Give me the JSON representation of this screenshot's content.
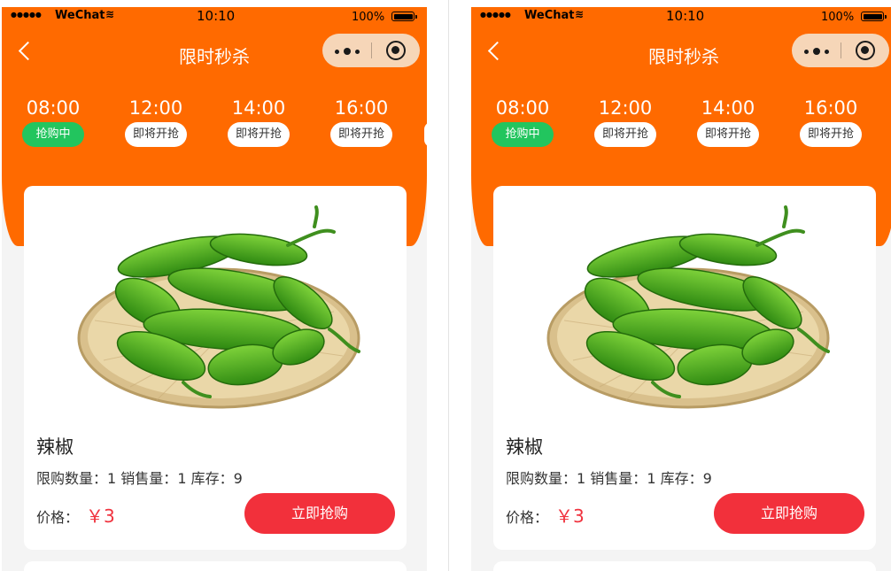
{
  "status_bar": {
    "signal": "●●●●●",
    "carrier": "WeChat",
    "time": "10:10",
    "battery_percent": "100%"
  },
  "header": {
    "title": "限时秒杀"
  },
  "time_tabs": [
    {
      "time": "08:00",
      "status": "抢购中",
      "active": true
    },
    {
      "time": "12:00",
      "status": "即将开抢",
      "active": false
    },
    {
      "time": "14:00",
      "status": "即将开抢",
      "active": false
    },
    {
      "time": "16:00",
      "status": "即将开抢",
      "active": false
    }
  ],
  "product": {
    "name": "辣椒",
    "limit_label": "限购数量：",
    "limit_value": "1",
    "sold_label": "销售量：",
    "sold_value": "1",
    "stock_label": "库存：",
    "stock_value": "9",
    "price_label": "价格：",
    "price": "￥3",
    "buy_button": "立即抢购"
  },
  "colors": {
    "header_orange": "#ff6a00",
    "active_green": "#22c55e",
    "buy_red": "#f2303b",
    "price_red": "#f0333f"
  },
  "icons": [
    "back-chevron-icon",
    "more-dots-icon",
    "target-circle-icon",
    "wifi-icon",
    "battery-icon"
  ]
}
